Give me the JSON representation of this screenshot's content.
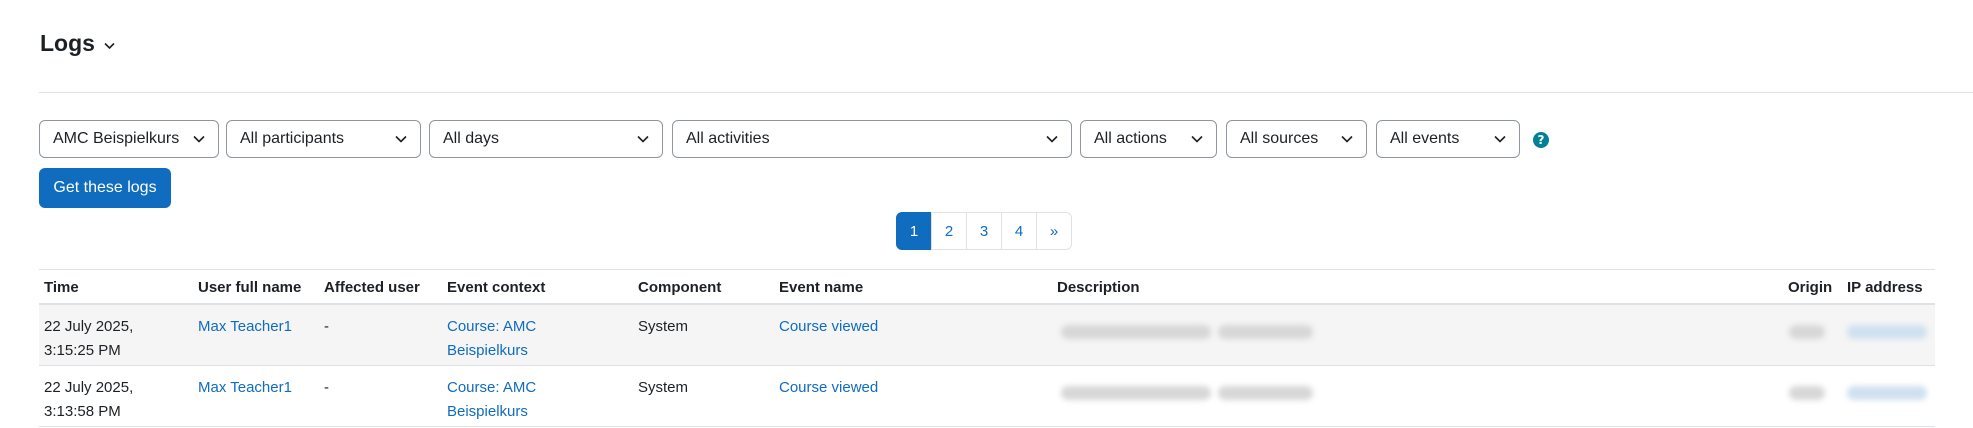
{
  "header": {
    "title": "Logs"
  },
  "filters": {
    "course": "AMC Beispielkurs",
    "participants": "All participants",
    "days": "All days",
    "activities": "All activities",
    "actions": "All actions",
    "sources": "All sources",
    "events": "All events",
    "help": "?"
  },
  "actions": {
    "get_logs": "Get these logs"
  },
  "pagination": {
    "pages": [
      "1",
      "2",
      "3",
      "4"
    ],
    "next": "»",
    "active": "1"
  },
  "table": {
    "headers": [
      "Time",
      "User full name",
      "Affected user",
      "Event context",
      "Component",
      "Event name",
      "Description",
      "Origin",
      "IP address"
    ],
    "rows": [
      {
        "time1": "22 July 2025,",
        "time2": "3:15:25 PM",
        "user": "Max Teacher1",
        "affected": "-",
        "context1": "Course: AMC",
        "context2": "Beispielkurs",
        "component": "System",
        "event": "Course viewed"
      },
      {
        "time1": "22 July 2025,",
        "time2": "3:13:58 PM",
        "user": "Max Teacher1",
        "affected": "-",
        "context1": "Course: AMC",
        "context2": "Beispielkurs",
        "component": "System",
        "event": "Course viewed"
      }
    ]
  },
  "colors": {
    "primary": "#0f6cbf",
    "help": "#008196",
    "border": "#dee2e6"
  }
}
